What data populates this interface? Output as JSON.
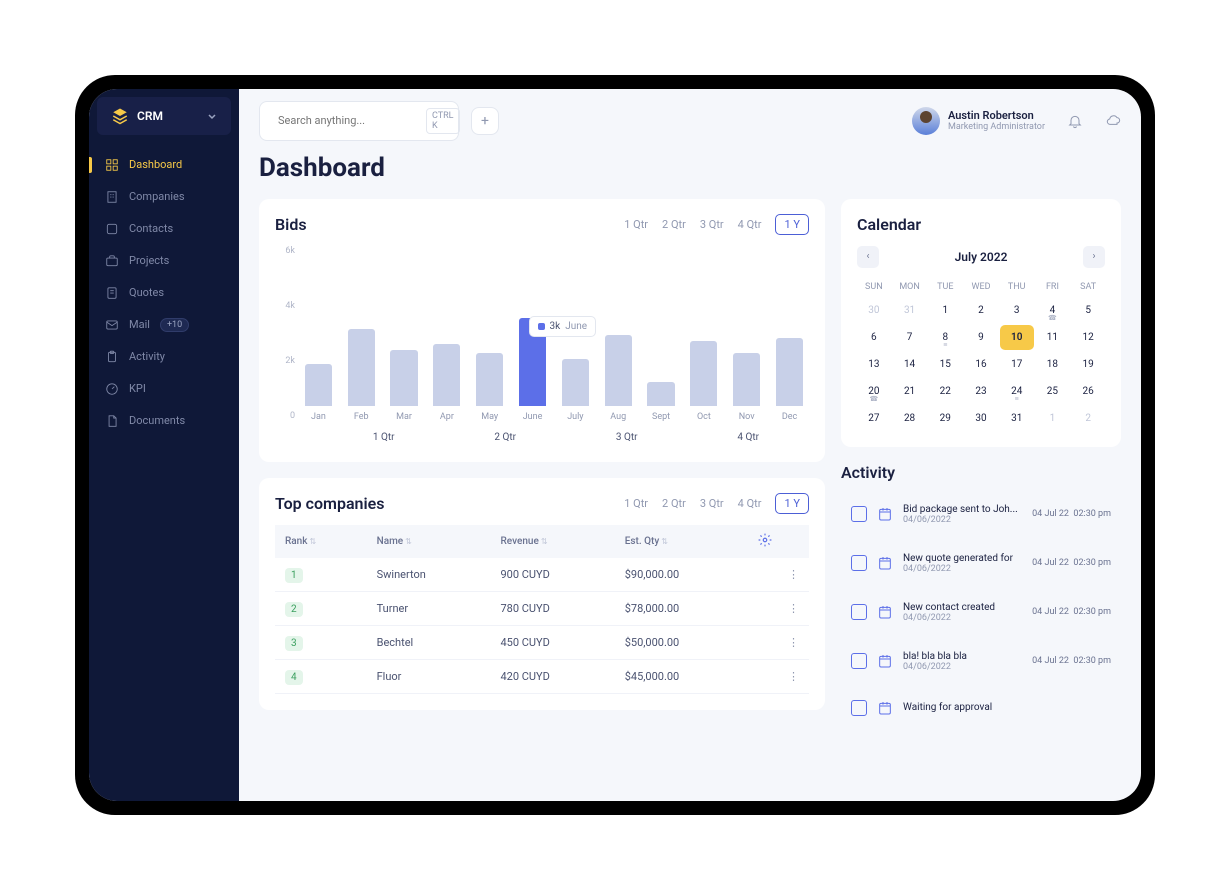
{
  "brand": "CRM",
  "nav": [
    {
      "label": "Dashboard",
      "icon": "grid"
    },
    {
      "label": "Companies",
      "icon": "building"
    },
    {
      "label": "Contacts",
      "icon": "user"
    },
    {
      "label": "Projects",
      "icon": "briefcase"
    },
    {
      "label": "Quotes",
      "icon": "note"
    },
    {
      "label": "Mail",
      "icon": "mail",
      "badge": "+10"
    },
    {
      "label": "Activity",
      "icon": "clipboard"
    },
    {
      "label": "KPI",
      "icon": "gauge"
    },
    {
      "label": "Documents",
      "icon": "doc"
    }
  ],
  "search": {
    "placeholder": "Search anything...",
    "shortcut": "CTRL K"
  },
  "user": {
    "name": "Austin Robertson",
    "role": "Marketing Administrator"
  },
  "page_title": "Dashboard",
  "bids": {
    "title": "Bids",
    "tabs": [
      "1 Qtr",
      "2 Qtr",
      "3 Qtr",
      "4 Qtr",
      "1 Y"
    ],
    "active_tab": "1 Y",
    "tooltip": {
      "value": "3k",
      "label": "June"
    },
    "quarters": [
      "1 Qtr",
      "2 Qtr",
      "3 Qtr",
      "4 Qtr"
    ]
  },
  "chart_data": {
    "type": "bar",
    "title": "Bids",
    "xlabel": "",
    "ylabel": "",
    "ylim": [
      0,
      6000
    ],
    "y_ticks": [
      "6k",
      "4k",
      "2k",
      "0"
    ],
    "categories": [
      "Jan",
      "Feb",
      "Mar",
      "Apr",
      "May",
      "June",
      "July",
      "Aug",
      "Sept",
      "Oct",
      "Nov",
      "Dec"
    ],
    "values": [
      1400,
      2600,
      1900,
      2100,
      1800,
      3000,
      1600,
      2400,
      800,
      2200,
      1800,
      2300
    ],
    "highlight_index": 5
  },
  "top_companies": {
    "title": "Top companies",
    "tabs": [
      "1 Qtr",
      "2 Qtr",
      "3 Qtr",
      "4 Qtr",
      "1 Y"
    ],
    "active_tab": "1 Y",
    "columns": [
      "Rank",
      "Name",
      "Revenue",
      "Est. Qty"
    ],
    "rows": [
      {
        "rank": "1",
        "name": "Swinerton",
        "revenue": "900 CUYD",
        "qty": "$90,000.00"
      },
      {
        "rank": "2",
        "name": "Turner",
        "revenue": "780 CUYD",
        "qty": "$78,000.00"
      },
      {
        "rank": "3",
        "name": "Bechtel",
        "revenue": "450 CUYD",
        "qty": "$50,000.00"
      },
      {
        "rank": "4",
        "name": "Fluor",
        "revenue": "420 CUYD",
        "qty": "$45,000.00"
      }
    ]
  },
  "calendar": {
    "title": "Calendar",
    "month": "July 2022",
    "dow": [
      "SUN",
      "MON",
      "TUE",
      "WED",
      "THU",
      "FRI",
      "SAT"
    ],
    "days": [
      {
        "n": "30",
        "muted": true
      },
      {
        "n": "31",
        "muted": true
      },
      {
        "n": "1"
      },
      {
        "n": "2"
      },
      {
        "n": "3"
      },
      {
        "n": "4",
        "ind": "☎"
      },
      {
        "n": "5"
      },
      {
        "n": "6"
      },
      {
        "n": "7"
      },
      {
        "n": "8",
        "ind": "≡"
      },
      {
        "n": "9"
      },
      {
        "n": "10",
        "today": true
      },
      {
        "n": "11"
      },
      {
        "n": "12"
      },
      {
        "n": "13"
      },
      {
        "n": "14"
      },
      {
        "n": "15"
      },
      {
        "n": "16"
      },
      {
        "n": "17"
      },
      {
        "n": "18"
      },
      {
        "n": "19"
      },
      {
        "n": "20",
        "ind": "☎"
      },
      {
        "n": "21"
      },
      {
        "n": "22"
      },
      {
        "n": "23"
      },
      {
        "n": "24",
        "ind": "≡"
      },
      {
        "n": "25"
      },
      {
        "n": "26"
      },
      {
        "n": "27"
      },
      {
        "n": "28"
      },
      {
        "n": "29"
      },
      {
        "n": "30"
      },
      {
        "n": "31"
      },
      {
        "n": "1",
        "muted": true
      },
      {
        "n": "2",
        "muted": true
      }
    ]
  },
  "activity": {
    "title": "Activity",
    "items": [
      {
        "title": "Bid package sent to Joh...",
        "sub": "04/06/2022",
        "date": "04 Jul 22",
        "time": "02:30 pm"
      },
      {
        "title": "New quote generated for",
        "sub": "04/06/2022",
        "date": "04 Jul 22",
        "time": "02:30 pm"
      },
      {
        "title": "New contact created",
        "sub": "04/06/2022",
        "date": "04 Jul 22",
        "time": "02:30 pm"
      },
      {
        "title": "bla! bla bla bla",
        "sub": "04/06/2022",
        "date": "04 Jul 22",
        "time": "02:30 pm"
      },
      {
        "title": "Waiting for approval",
        "sub": "",
        "date": "",
        "time": ""
      }
    ]
  }
}
